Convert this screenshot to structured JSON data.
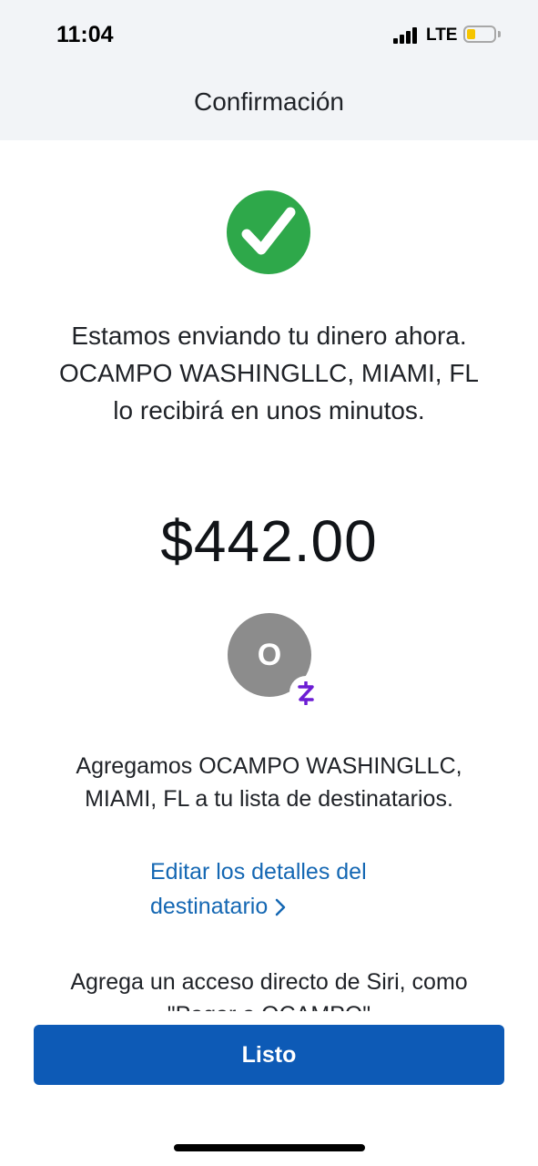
{
  "status_bar": {
    "time": "11:04",
    "network": "LTE",
    "icons": [
      "signal-icon",
      "battery-icon"
    ],
    "battery_color": "#f6c500"
  },
  "header": {
    "title": "Confirmación"
  },
  "confirmation": {
    "icon": "checkmark-circle-icon",
    "icon_color": "#2ea84a",
    "message": "Estamos enviando tu dinero ahora. OCAMPO WASHINGLLC, MIAMI, FL lo recibirá en unos minutos.",
    "amount": "$442.00"
  },
  "recipient": {
    "avatar_initial": "O",
    "avatar_color": "#8c8c8c",
    "badge_icon": "zelle-icon",
    "badge_color": "#6d1ed4",
    "added_message": "Agregamos OCAMPO WASHINGLLC, MIAMI, FL a tu lista de destinatarios.",
    "edit_link_label": "Editar los detalles del destinatario"
  },
  "siri": {
    "text": "Agrega un acceso directo de Siri, como \"Pagar a OCAMPO\""
  },
  "actions": {
    "done_label": "Listo",
    "button_color": "#0d5ab6",
    "link_color": "#1467b3"
  }
}
